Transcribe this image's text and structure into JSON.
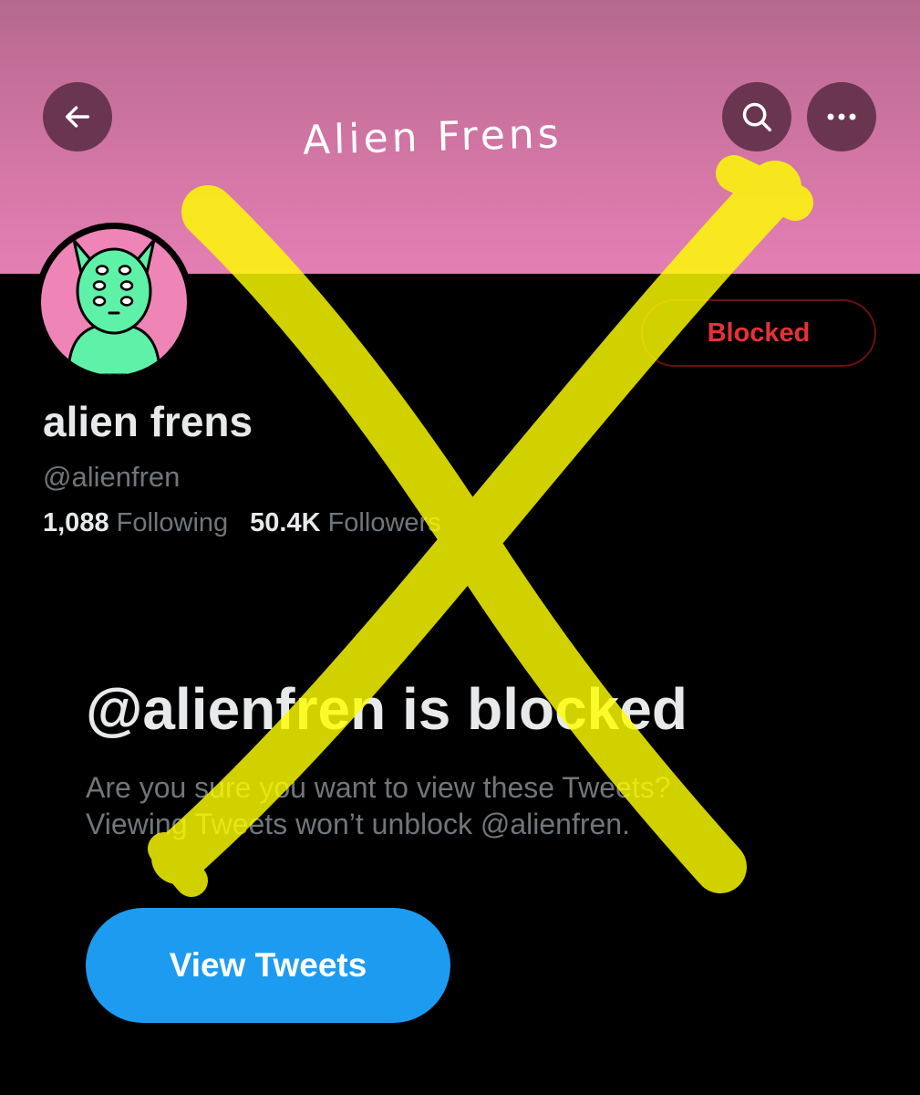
{
  "header": {
    "banner_title": "Alien Frens",
    "back_icon": "arrow-left-icon",
    "search_icon": "search-icon",
    "more_icon": "more-horizontal-icon"
  },
  "profile": {
    "display_name": "alien frens",
    "handle": "@alienfren",
    "blocked_label": "Blocked",
    "following_count": "1,088",
    "following_label": "Following",
    "followers_count": "50.4K",
    "followers_label": "Followers"
  },
  "blocked_notice": {
    "title": "@alienfren is blocked",
    "line1": "Are you sure you want to view these Tweets?",
    "line2": "Viewing Tweets won’t unblock @alienfren.",
    "button_label": "View Tweets"
  },
  "colors": {
    "banner": "#cf74a2",
    "blocked_red": "#e53237",
    "primary_blue": "#1d9bf0",
    "overlay_yellow": "#ffff00"
  }
}
